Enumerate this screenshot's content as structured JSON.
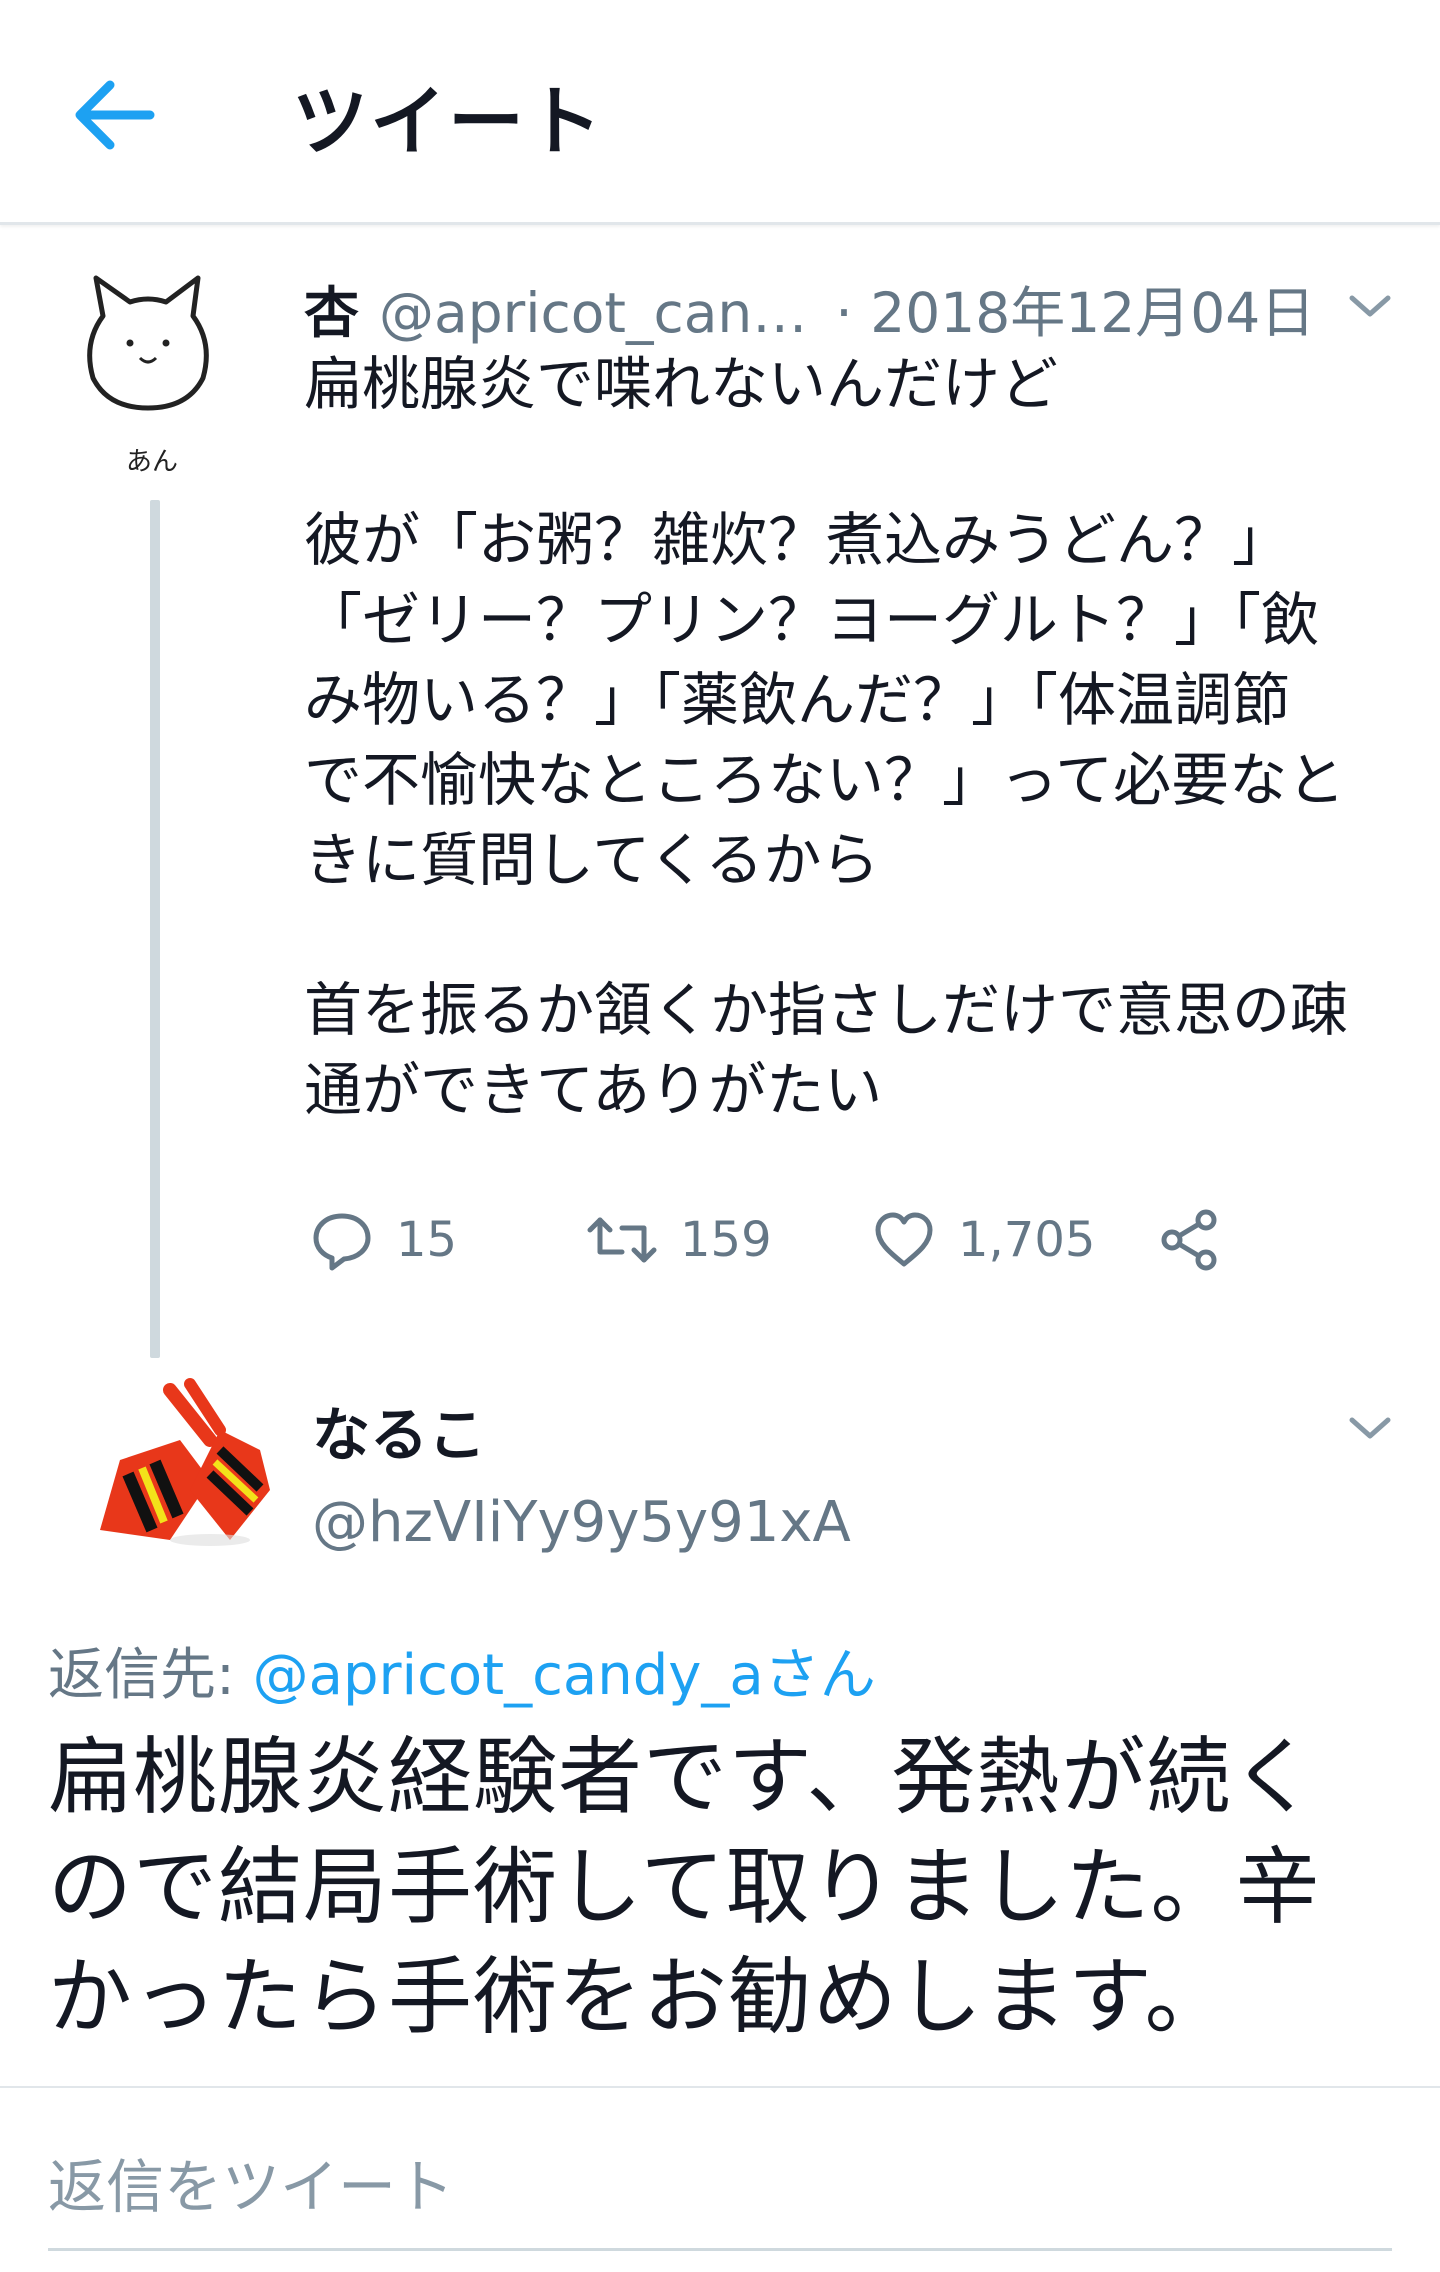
{
  "header": {
    "title": "ツイート",
    "back_icon": "arrow-left-icon"
  },
  "original_tweet": {
    "avatar_caption": "あん",
    "name": "杏",
    "handle": "@apricot_can…",
    "date": "· 2018年12月04日",
    "body": {
      "paragraph1": [
        "扁桃腺炎で喋れないんだけど"
      ],
      "paragraph2": [
        "彼が「お粥？雑炊？煮込みうどん？」",
        "「ゼリー？プリン？ヨーグルト？」「飲",
        "み物いる？」「薬飲んだ？」「体温調節",
        "で不愉快なところない？」って必要なと",
        "きに質問してくるから"
      ],
      "paragraph3": [
        "首を振るか頷くか指さしだけで意思の疎",
        "通ができてありがたい"
      ]
    },
    "actions": {
      "reply_count": "15",
      "retweet_count": "159",
      "like_count": "1,705"
    }
  },
  "reply_tweet": {
    "name": "なるこ",
    "handle": "@hzVIiYy9y5y91xA",
    "reply_to_label": "返信先: ",
    "reply_to_handle": "@apricot_candy_aさん",
    "body": [
      "扁桃腺炎経験者です、発熱が続く",
      "ので結局手術して取りました。辛",
      "かったら手術をお勧めします。"
    ]
  },
  "composer": {
    "placeholder": "返信をツイート"
  },
  "colors": {
    "accent": "#1da1f2",
    "text_primary": "#141823",
    "text_secondary": "#657786",
    "divider": "#e1e6ea"
  }
}
